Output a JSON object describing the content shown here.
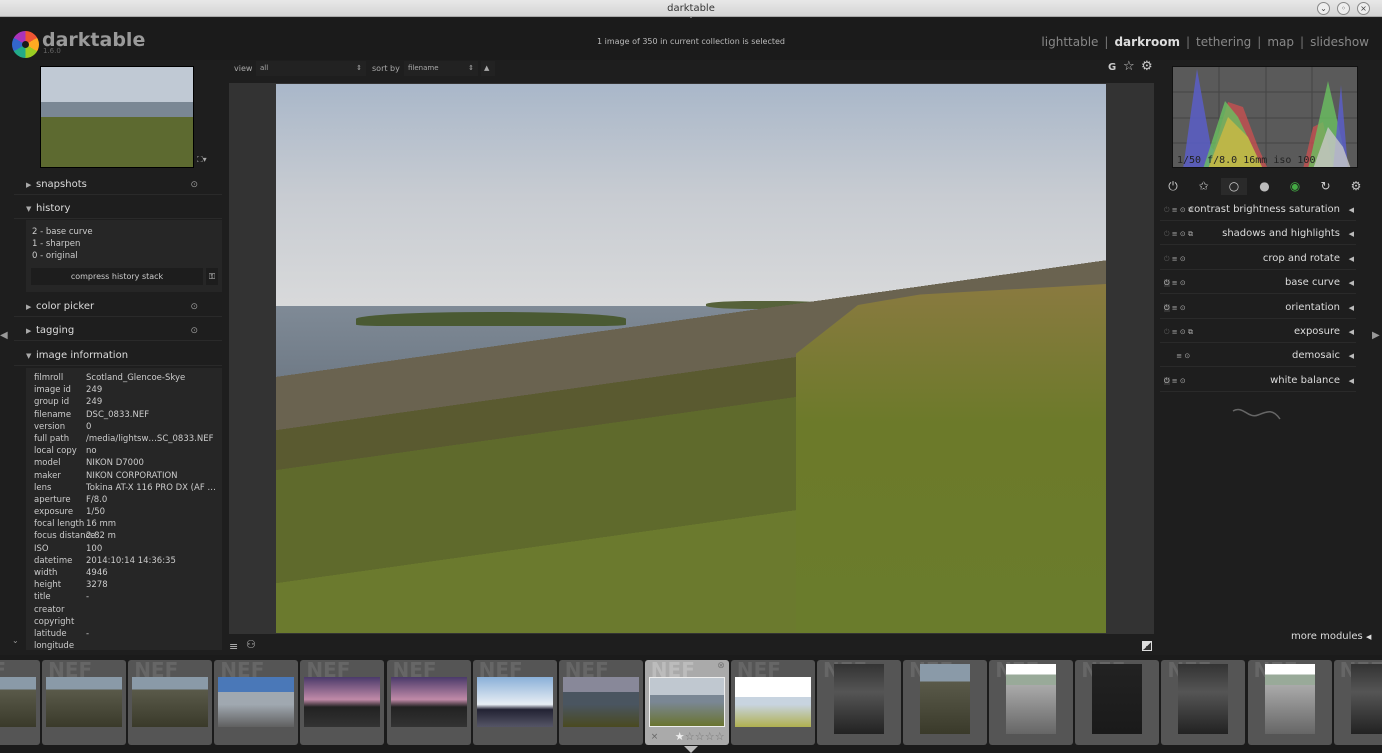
{
  "window": {
    "title": "darktable"
  },
  "app": {
    "name": "darktable",
    "version": "1.6.0"
  },
  "status": "1 image of 350 in current collection is selected",
  "views": [
    {
      "label": "lighttable",
      "active": false
    },
    {
      "label": "darkroom",
      "active": true
    },
    {
      "label": "tethering",
      "active": false
    },
    {
      "label": "map",
      "active": false
    },
    {
      "label": "slideshow",
      "active": false
    }
  ],
  "topbar": {
    "view_label": "view",
    "view_value": "all",
    "sort_label": "sort by",
    "sort_value": "filename",
    "g_label": "G"
  },
  "left": {
    "sections": {
      "snapshots": "snapshots",
      "history": "history",
      "color_picker": "color picker",
      "tagging": "tagging",
      "image_information": "image information"
    },
    "history": [
      "2 - base curve",
      "1 - sharpen",
      "0 - original"
    ],
    "compress_label": "compress history stack",
    "info": [
      [
        "filmroll",
        "Scotland_Glencoe-Skye"
      ],
      [
        "image id",
        "249"
      ],
      [
        "group id",
        "249"
      ],
      [
        "filename",
        "DSC_0833.NEF"
      ],
      [
        "version",
        "0"
      ],
      [
        "full path",
        "/media/lightsw…SC_0833.NEF"
      ],
      [
        "local copy",
        "no"
      ],
      [
        "model",
        "NIKON D7000"
      ],
      [
        "maker",
        "NIKON CORPORATION"
      ],
      [
        "lens",
        "Tokina AT-X 116 PRO DX (AF …"
      ],
      [
        "aperture",
        "F/8.0"
      ],
      [
        "exposure",
        "1/50"
      ],
      [
        "focal length",
        "16 mm"
      ],
      [
        "focus distance",
        "2.82 m"
      ],
      [
        "ISO",
        "100"
      ],
      [
        "datetime",
        "2014:10:14 14:36:35"
      ],
      [
        "width",
        "4946"
      ],
      [
        "height",
        "3278"
      ],
      [
        "title",
        "-"
      ],
      [
        "creator",
        ""
      ],
      [
        "copyright",
        ""
      ],
      [
        "latitude",
        "-"
      ],
      [
        "longitude",
        ""
      ]
    ]
  },
  "right": {
    "histogram_info": "1/50 f/8.0 16mm iso 100",
    "groups": [
      "power",
      "star",
      "circle",
      "sphere",
      "color",
      "rotate",
      "settings"
    ],
    "modules": [
      {
        "label": "contrast brightness saturation",
        "on": false,
        "preset": true
      },
      {
        "label": "shadows and highlights",
        "on": false,
        "preset": true
      },
      {
        "label": "crop and rotate",
        "on": false,
        "preset": false
      },
      {
        "label": "base curve",
        "on": true,
        "preset": false
      },
      {
        "label": "orientation",
        "on": true,
        "preset": false
      },
      {
        "label": "exposure",
        "on": false,
        "preset": true
      },
      {
        "label": "demosaic",
        "on": null,
        "preset": false
      },
      {
        "label": "white balance",
        "on": true,
        "preset": false
      }
    ],
    "more_modules": "more modules"
  },
  "filmstrip": {
    "badge": "NEF",
    "selected_index": 8,
    "rating": 1,
    "thumbs": [
      {
        "orient": "l",
        "tone": "rock"
      },
      {
        "orient": "l",
        "tone": "rock"
      },
      {
        "orient": "l",
        "tone": "rock"
      },
      {
        "orient": "l",
        "tone": "coastblue"
      },
      {
        "orient": "l",
        "tone": "sunset"
      },
      {
        "orient": "l",
        "tone": "sunset"
      },
      {
        "orient": "l",
        "tone": "sky"
      },
      {
        "orient": "l",
        "tone": "dark"
      },
      {
        "orient": "l",
        "tone": "coast"
      },
      {
        "orient": "l",
        "tone": "bright"
      },
      {
        "orient": "p",
        "tone": "darkrock"
      },
      {
        "orient": "p",
        "tone": "rock"
      },
      {
        "orient": "p",
        "tone": "brightrock"
      },
      {
        "orient": "p",
        "tone": "black"
      },
      {
        "orient": "p",
        "tone": "darkrock"
      },
      {
        "orient": "p",
        "tone": "brightrock"
      },
      {
        "orient": "p",
        "tone": "darkrock"
      }
    ]
  }
}
